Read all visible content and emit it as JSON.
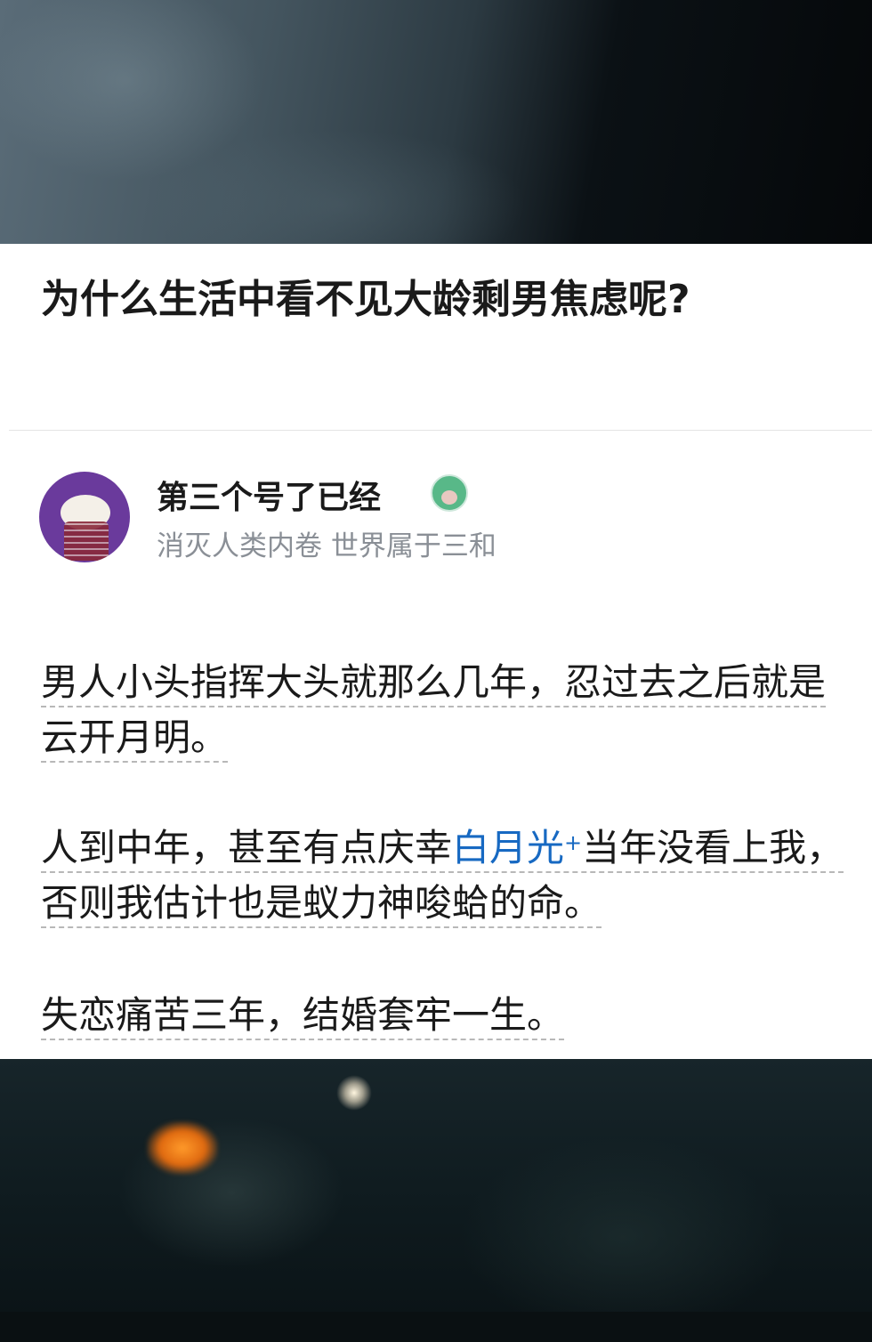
{
  "question": {
    "title": "为什么生活中看不见大龄剩男焦虑呢?"
  },
  "author": {
    "name": "第三个号了已经",
    "bio": "消灭人类内卷 世界属于三和"
  },
  "answer": {
    "p1": "男人小头指挥大头就那么几年，忍过去之后就是云开月明。",
    "p2_before": "人到中年，甚至有点庆幸",
    "p2_link": "白月光",
    "p2_link_mark": "+",
    "p2_after": "当年没看上我，否则我估计也是蚁力神唆蛤的命。",
    "p3": "失恋痛苦三年，结婚套牢一生。"
  },
  "colors": {
    "link": "#1769c2",
    "text": "#1a1a1a",
    "bio": "#8a8f96",
    "avatar_bg": "#6a3a9c"
  }
}
